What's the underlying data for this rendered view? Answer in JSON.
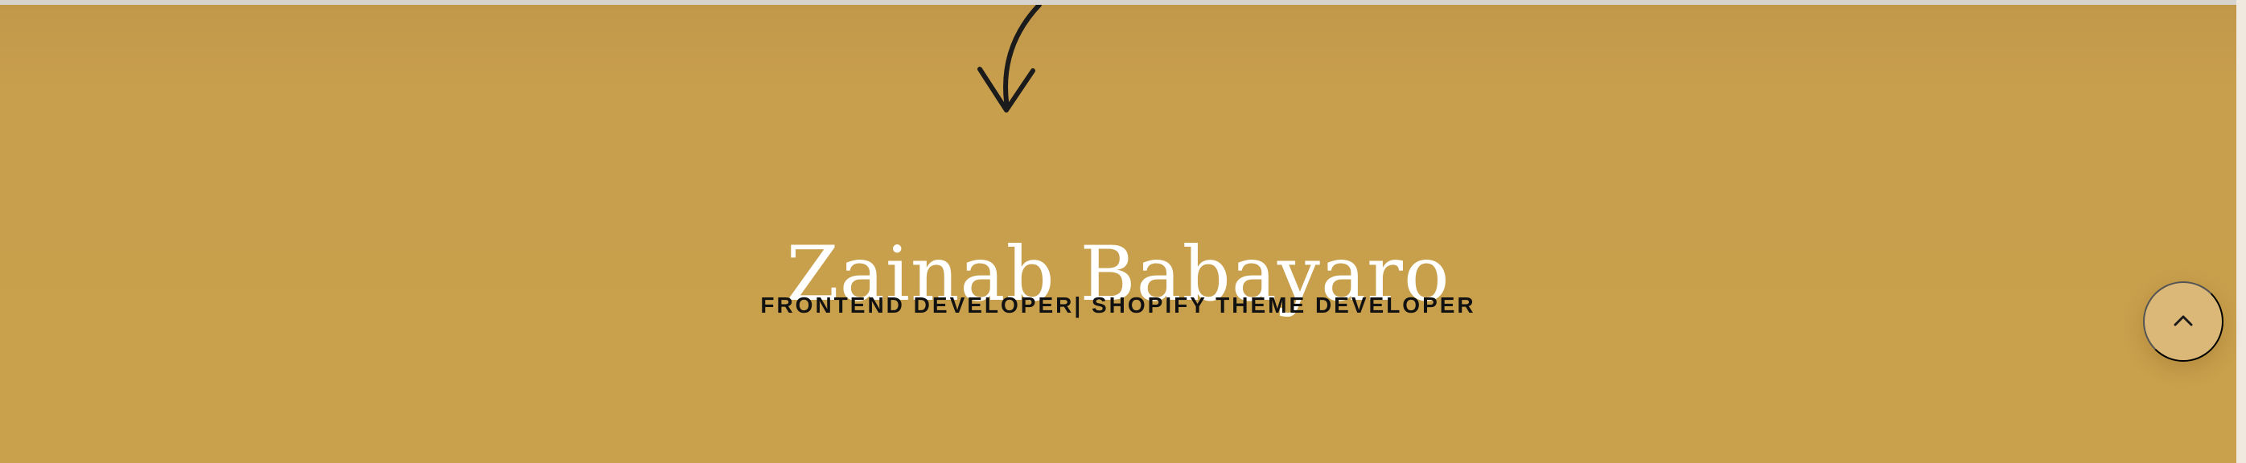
{
  "hero": {
    "name": "Zainab Babayaro",
    "role": "FRONTEND DEVELOPER| SHOPIFY THEME DEVELOPER",
    "background_color": "#c9a04c",
    "text_color": "#ffffff"
  },
  "icons": {
    "arrow": "arrow-down-icon",
    "scroll_top": "chevron-up-icon"
  },
  "scroll_top_button": {
    "color": "#dbb877"
  }
}
